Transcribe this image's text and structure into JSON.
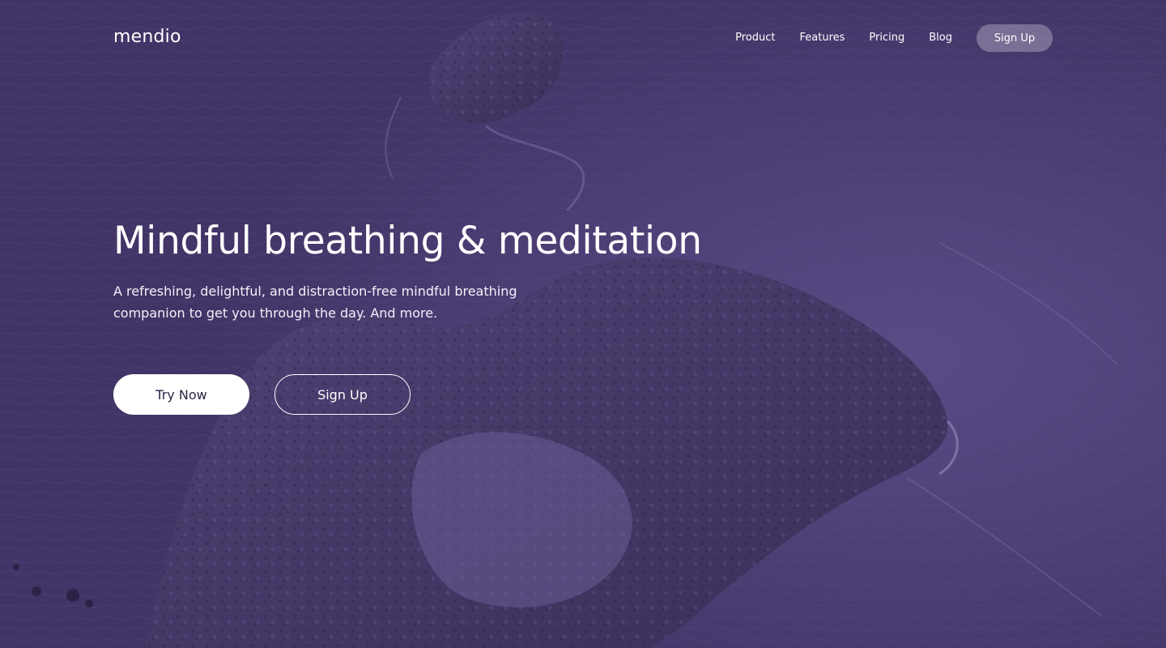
{
  "brand": {
    "logo_text": "mendio"
  },
  "nav": {
    "links": [
      "Product",
      "Features",
      "Pricing",
      "Blog"
    ],
    "signup_label": "Sign Up"
  },
  "hero": {
    "headline": "Mindful breathing & meditation",
    "subtitle": "A refreshing, delightful, and distraction-free mindful breathing companion to get you through the day. And more.",
    "primary_cta": "Try Now",
    "secondary_cta": "Sign Up",
    "background_image": "aerial-ocean-rocks",
    "overlay_color": "#453766"
  },
  "colors": {
    "overlay": "#453766",
    "text": "#ffffff",
    "button_text_dark": "#2e2445"
  }
}
